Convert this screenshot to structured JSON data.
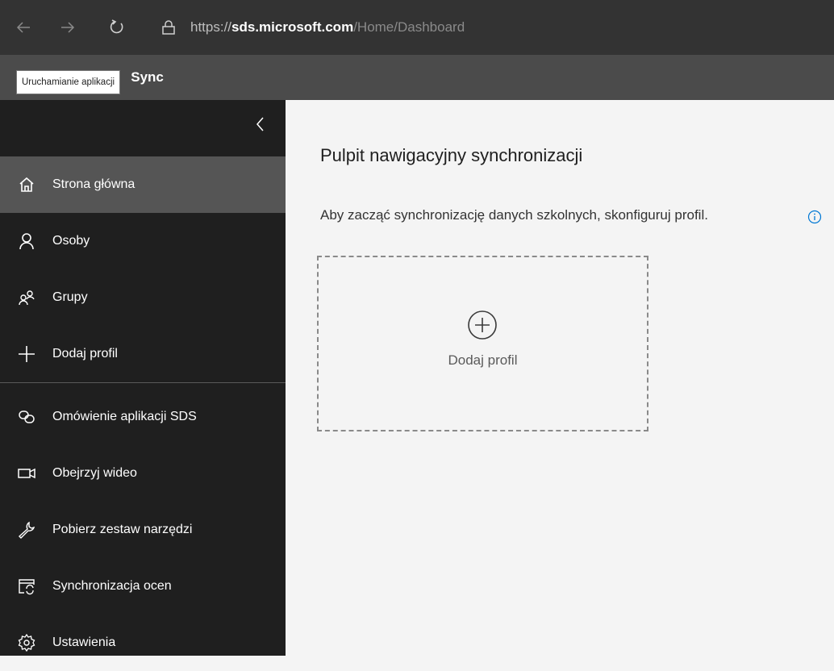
{
  "browser": {
    "url_scheme": "https://",
    "url_host": "sds.microsoft.com",
    "url_path": "/Home/Dashboard"
  },
  "header": {
    "app_title": "Sync",
    "launcher_tooltip": "Uruchamianie aplikacji"
  },
  "sidebar": {
    "items": [
      {
        "label": "Strona główna",
        "icon": "home-icon",
        "active": true
      },
      {
        "label": "Osoby",
        "icon": "person-icon"
      },
      {
        "label": "Grupy",
        "icon": "people-icon"
      },
      {
        "label": "Dodaj profil",
        "icon": "plus-icon"
      },
      {
        "label": "Omówienie aplikacji SDS",
        "icon": "link-icon"
      },
      {
        "label": "Obejrzyj wideo",
        "icon": "video-icon"
      },
      {
        "label": "Pobierz zestaw narzędzi",
        "icon": "wrench-icon"
      },
      {
        "label": "Synchronizacja ocen",
        "icon": "sync-grades-icon"
      },
      {
        "label": "Ustawienia",
        "icon": "gear-icon"
      }
    ]
  },
  "main": {
    "title": "Pulpit nawigacyjny synchronizacji",
    "intro": "Aby zacząć synchronizację danych szkolnych, skonfiguruj profil.",
    "add_profile_label": "Dodaj profil"
  },
  "colors": {
    "browser_bar": "#333333",
    "app_header": "#4b4b4b",
    "sidebar": "#1f1f1f",
    "sidebar_active": "#555555",
    "main_bg": "#f4f4f4",
    "info_accent": "#0078d4"
  }
}
